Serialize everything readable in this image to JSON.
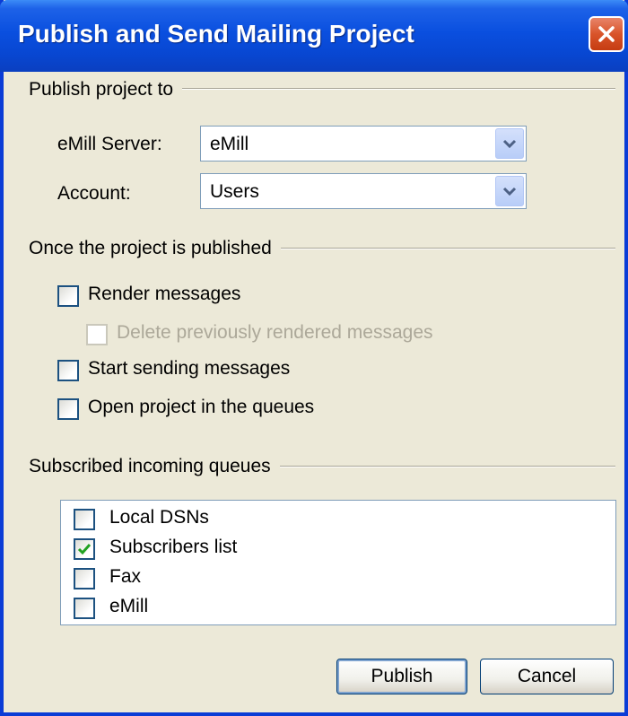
{
  "window": {
    "title": "Publish and Send Mailing Project"
  },
  "publish_group": {
    "label": "Publish project to",
    "server_label": "eMill Server:",
    "server_value": "eMill",
    "account_label": "Account:",
    "account_value": "Users"
  },
  "after_publish_group": {
    "label": "Once the project is published",
    "options": [
      {
        "label": "Render messages",
        "checked": false,
        "enabled": true
      },
      {
        "label": "Delete previously rendered messages",
        "checked": false,
        "enabled": false
      },
      {
        "label": "Start sending messages",
        "checked": false,
        "enabled": true
      },
      {
        "label": "Open project in the queues",
        "checked": false,
        "enabled": true
      }
    ]
  },
  "queues_group": {
    "label": "Subscribed incoming queues",
    "items": [
      {
        "label": "Local DSNs",
        "checked": false
      },
      {
        "label": "Subscribers list",
        "checked": true
      },
      {
        "label": "Fax",
        "checked": false
      },
      {
        "label": "eMill",
        "checked": false
      }
    ]
  },
  "buttons": {
    "publish": "Publish",
    "cancel": "Cancel"
  },
  "colors": {
    "titlebar": "#0a4fdf",
    "check_mark": "#21a121",
    "dialog_bg": "#ece9d8"
  }
}
